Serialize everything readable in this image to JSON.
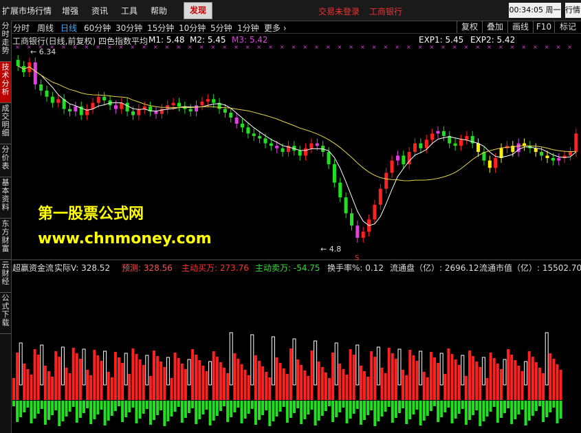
{
  "menubar": {
    "items": [
      "扩展市场行情",
      "增强",
      "资讯",
      "工具",
      "帮助"
    ],
    "find_label": "发现",
    "login_status": "交易未登录",
    "stock_name": "工商银行",
    "clock": "00:34:05 周一",
    "right_label": "行情"
  },
  "sidebar": {
    "tabs": [
      "分时走势",
      "技术分析",
      "成交明细",
      "分价表",
      "基本资料",
      "东方财富",
      "云财经",
      "公式下载"
    ]
  },
  "periods": [
    "分时",
    "周线",
    "日线",
    "60分钟",
    "30分钟",
    "15分钟",
    "10分钟",
    "5分钟",
    "1分钟",
    "更多 ›"
  ],
  "toolbar": [
    "复权",
    "叠加",
    "画线",
    "F10",
    "标记"
  ],
  "main_legend": {
    "title": "工商银行(日线,前复权) 四色指数平均",
    "m1": "M1: 5.48",
    "m2": "M2: 5.45",
    "m3": "M3: 5.42",
    "exp1": "EXP1: 5.45",
    "exp2": "EXP2: 5.42",
    "high_label": "6.34",
    "low_label": "4.8",
    "s_marker": "S"
  },
  "watermark": {
    "line1": "第一股票公式网",
    "line2": "www.chnmoney.com"
  },
  "indicator": {
    "name": "超赢资金流",
    "actual": "实际V: 328.52",
    "forecast": "预测: 328.56",
    "active_buy": "主动买万: 273.76",
    "active_sell": "主动卖万: -54.75",
    "turnover": "换手率%: 0.12",
    "float_shares": "流通盘（亿）: 2696.12",
    "float_value": "流通市值（亿）: 15502.70"
  },
  "colors": {
    "up": "#ff2020",
    "down": "#20e020",
    "magenta": "#e040e0",
    "yellow": "#ffee00",
    "ma_white": "#ffffff",
    "ma_yellow": "#e8d44a"
  },
  "chart_data": {
    "type": "candlestick",
    "y_range": [
      4.8,
      6.34
    ],
    "close_series": [
      6.25,
      6.2,
      6.28,
      6.1,
      6.05,
      6.0,
      5.95,
      5.98,
      5.9,
      5.88,
      5.92,
      5.85,
      5.9,
      5.95,
      6.0,
      5.97,
      5.93,
      5.9,
      5.95,
      5.88,
      5.85,
      5.9,
      5.92,
      5.88,
      5.86,
      5.9,
      5.93,
      5.95,
      5.92,
      5.9,
      5.88,
      5.93,
      5.96,
      5.98,
      5.95,
      5.9,
      5.87,
      5.83,
      5.78,
      5.75,
      5.7,
      5.68,
      5.66,
      5.62,
      5.6,
      5.58,
      5.55,
      5.6,
      5.56,
      5.52,
      5.58,
      5.62,
      5.6,
      5.55,
      5.45,
      5.3,
      5.18,
      5.05,
      4.95,
      4.85,
      4.9,
      5.0,
      5.12,
      5.25,
      5.38,
      5.48,
      5.52,
      5.45,
      5.55,
      5.62,
      5.58,
      5.65,
      5.7,
      5.72,
      5.68,
      5.62,
      5.6,
      5.65,
      5.68,
      5.62,
      5.55,
      5.48,
      5.42,
      5.5,
      5.58,
      5.6,
      5.55,
      5.62,
      5.6,
      5.58,
      5.55,
      5.52,
      5.5,
      5.48,
      5.5,
      5.52,
      5.55,
      5.7
    ]
  }
}
